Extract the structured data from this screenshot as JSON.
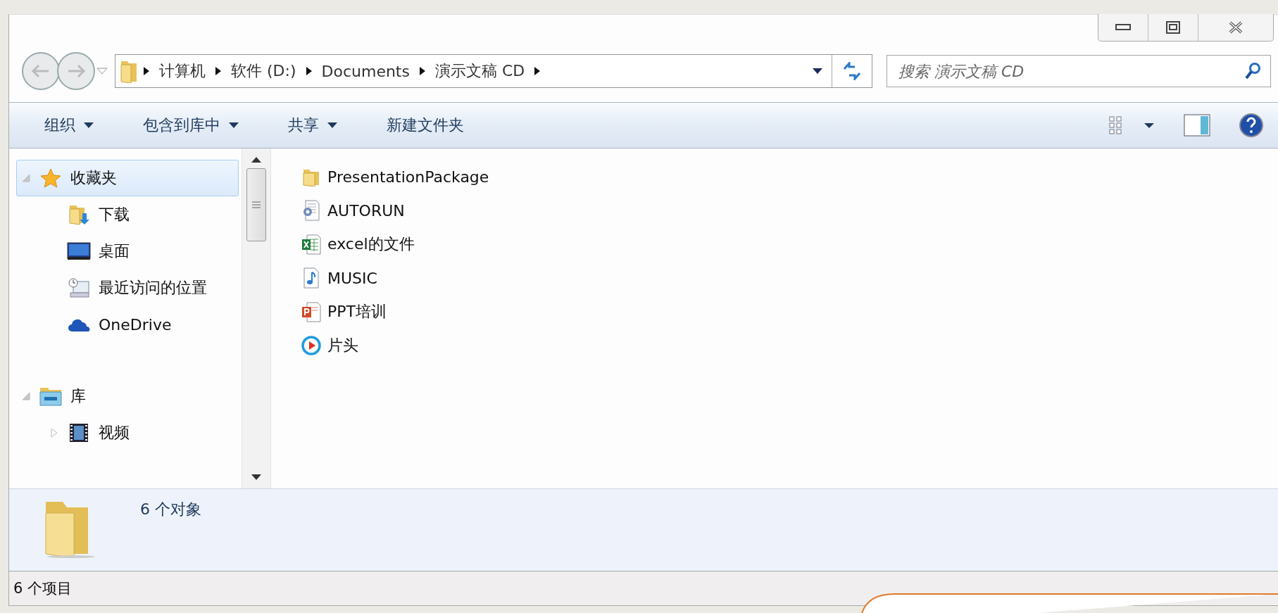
{
  "address_bar": {
    "crumbs": [
      "计算机",
      "软件 (D:)",
      "Documents",
      "演示文稿 CD"
    ]
  },
  "search": {
    "placeholder": "搜索 演示文稿 CD"
  },
  "toolbar": {
    "menus": [
      {
        "label": "组织",
        "dropdown": true
      },
      {
        "label": "包含到库中",
        "dropdown": true
      },
      {
        "label": "共享",
        "dropdown": true
      },
      {
        "label": "新建文件夹",
        "dropdown": false
      }
    ]
  },
  "navigation": {
    "items": [
      {
        "label": "收藏夹",
        "kind": "star",
        "expanded": true,
        "selected": true,
        "children": [
          {
            "label": "下载",
            "kind": "downloads"
          },
          {
            "label": "桌面",
            "kind": "desktop"
          },
          {
            "label": "最近访问的位置",
            "kind": "recent"
          },
          {
            "label": "OneDrive",
            "kind": "cloud"
          }
        ]
      },
      {
        "label": "库",
        "kind": "library",
        "expanded": true,
        "selected": false,
        "children": [
          {
            "label": "视频",
            "kind": "video",
            "expanded": false
          }
        ]
      }
    ]
  },
  "files": [
    {
      "name": "PresentationPackage",
      "kind": "folder"
    },
    {
      "name": "AUTORUN",
      "kind": "config"
    },
    {
      "name": "excel的文件",
      "kind": "excel"
    },
    {
      "name": "MUSIC",
      "kind": "audio"
    },
    {
      "name": "PPT培训",
      "kind": "ppt"
    },
    {
      "name": "片头",
      "kind": "video"
    }
  ],
  "details_pane": {
    "summary": "6 个对象"
  },
  "status_bar": {
    "text": "6 个项目"
  }
}
